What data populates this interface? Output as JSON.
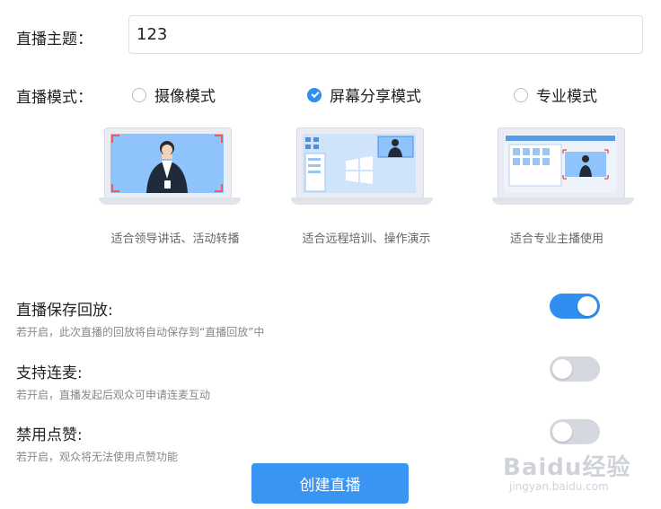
{
  "topic": {
    "label": "直播主题：",
    "value": "123"
  },
  "mode": {
    "label": "直播模式：",
    "options": [
      {
        "label": "摄像模式",
        "checked": false,
        "caption": "适合领导讲话、活动转播"
      },
      {
        "label": "屏幕分享模式",
        "checked": true,
        "caption": "适合远程培训、操作演示"
      },
      {
        "label": "专业模式",
        "checked": false,
        "caption": "适合专业主播使用"
      }
    ]
  },
  "settings": [
    {
      "title": "直播保存回放:",
      "desc": "若开启，此次直播的回放将自动保存到“直播回放”中",
      "on": true
    },
    {
      "title": "支持连麦:",
      "desc": "若开启，直播发起后观众可申请连麦互动",
      "on": false
    },
    {
      "title": "禁用点赞:",
      "desc": "若开启，观众将无法使用点赞功能",
      "on": false
    }
  ],
  "create_button": "创建直播",
  "watermark": {
    "logo": "Baidu经验",
    "url": "jingyan.baidu.com"
  },
  "colors": {
    "accent": "#2f8ef0",
    "switch_off": "#d5d8de"
  }
}
